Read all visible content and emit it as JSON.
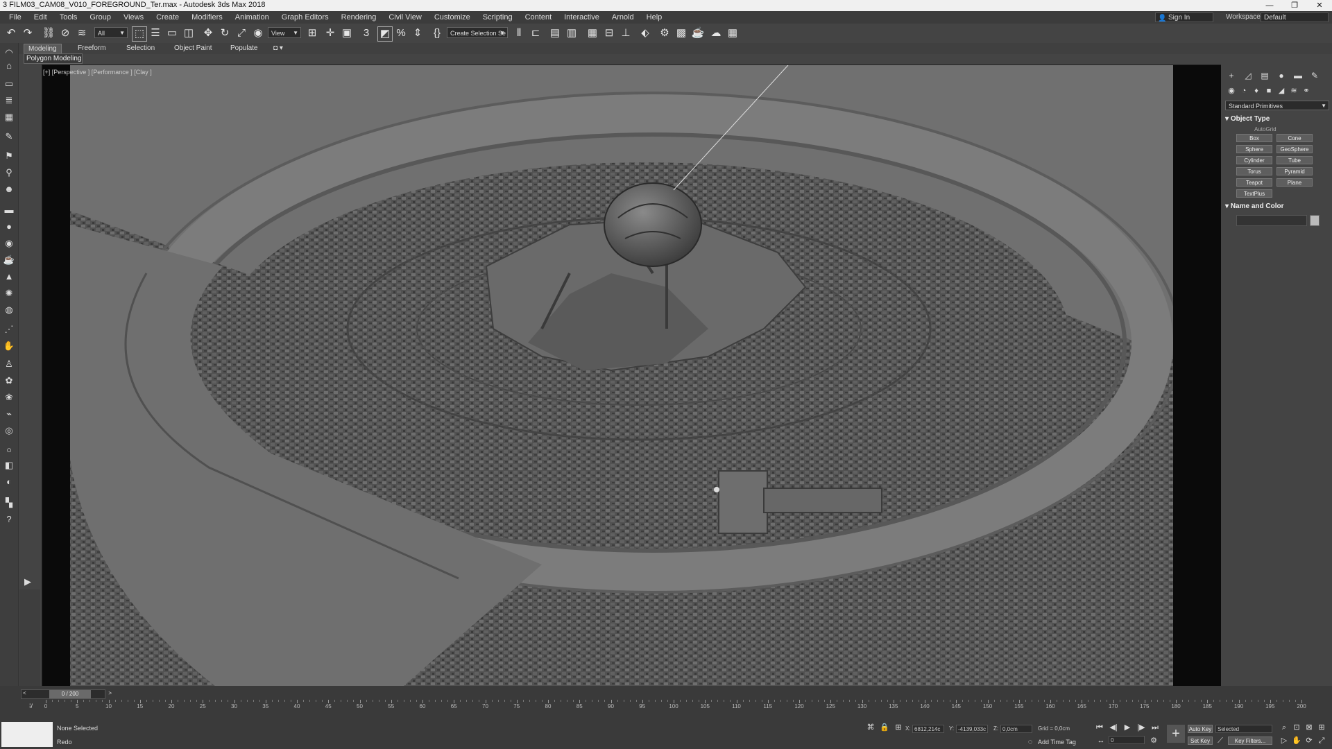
{
  "window": {
    "title": "3  FILM03_CAM08_V010_FOREGROUND_Ter.max - Autodesk 3ds Max 2018",
    "controls": [
      "—",
      "❐",
      "✕"
    ]
  },
  "menu": {
    "items": [
      "File",
      "Edit",
      "Tools",
      "Group",
      "Views",
      "Create",
      "Modifiers",
      "Animation",
      "Graph Editors",
      "Rendering",
      "Civil View",
      "Customize",
      "Scripting",
      "Content",
      "Interactive",
      "Arnold",
      "Help"
    ],
    "sign_in": "Sign In",
    "workspaces_label": "Workspaces:",
    "workspaces_value": "Default"
  },
  "toolbar": {
    "selection_filter": "All",
    "ref_coord": "View",
    "named_selection": "Create Selection Se"
  },
  "ribbon": {
    "tabs": [
      "Modeling",
      "Freeform",
      "Selection",
      "Object Paint",
      "Populate"
    ],
    "active_tab": "Modeling",
    "sub_label": "Polygon Modeling"
  },
  "viewport": {
    "label": "[+] [Perspective ] [Performance ] [Clay ]"
  },
  "command_panel": {
    "dropdown": "Standard Primitives",
    "object_type_title": "Object Type",
    "autogrid": "AutoGrid",
    "primitives": [
      "Box",
      "Cone",
      "Sphere",
      "GeoSphere",
      "Cylinder",
      "Tube",
      "Torus",
      "Pyramid",
      "Teapot",
      "Plane",
      "TextPlus"
    ],
    "name_color_title": "Name and Color"
  },
  "timeline": {
    "frame_display": "0 / 200",
    "ticks": [
      0,
      5,
      10,
      15,
      20,
      25,
      30,
      35,
      40,
      45,
      50,
      55,
      60,
      65,
      70,
      75,
      80,
      85,
      90,
      95,
      100,
      105,
      110,
      115,
      120,
      125,
      130,
      135,
      140,
      145,
      150,
      155,
      160,
      165,
      170,
      175,
      180,
      185,
      190,
      195,
      200
    ]
  },
  "status": {
    "selection": "None Selected",
    "prompt": "Redo",
    "x_label": "X:",
    "x_value": "6812,214c",
    "y_label": "Y:",
    "y_value": "-4139,033c",
    "z_label": "Z:",
    "z_value": "0,0cm",
    "grid": "Grid = 0,0cm",
    "add_time_tag": "Add Time Tag",
    "auto_key": "Auto Key",
    "set_key": "Set Key",
    "key_mode": "Selected",
    "key_filters": "Key Filters...",
    "frame_field": "0"
  }
}
